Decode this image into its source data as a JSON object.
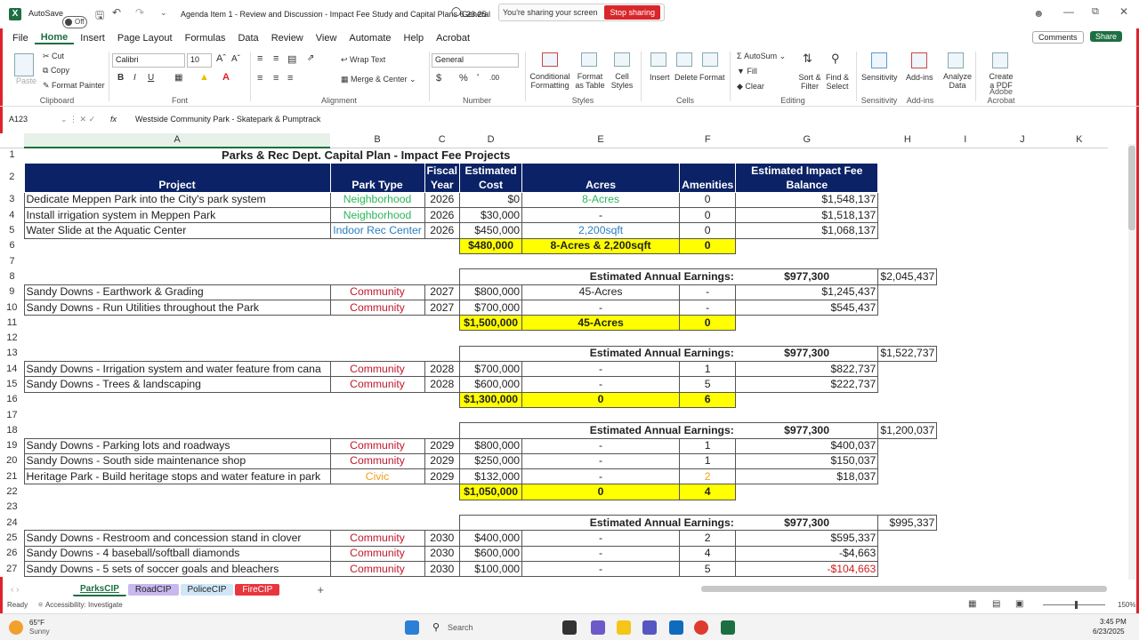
{
  "titlebar": {
    "autosave": "AutoSave",
    "toggle": "Off",
    "doc_title": "Agenda Item 1 - Review and Discussion - Impact Fee Study and  Capital Plans 6.23.25",
    "sensitivity": "General",
    "sharing_text": "You're sharing your screen",
    "stop_label": "Stop sharing"
  },
  "menu": [
    "File",
    "Home",
    "Insert",
    "Page Layout",
    "Formulas",
    "Data",
    "Review",
    "View",
    "Automate",
    "Help",
    "Acrobat"
  ],
  "comments_label": "Comments",
  "share_label": "Share",
  "ribbon": {
    "paste": "Paste",
    "cut": "Cut",
    "copy": "Copy",
    "format_painter": "Format Painter",
    "clipboard": "Clipboard",
    "font_name": "Calibri",
    "font_size": "10",
    "font": "Font",
    "wrap_text": "Wrap Text",
    "merge_center": "Merge & Center",
    "alignment": "Alignment",
    "number_format": "General",
    "number": "Number",
    "conditional": "Conditional Formatting",
    "format_table": "Format as Table",
    "cell_styles": "Cell Styles",
    "styles": "Styles",
    "insert": "Insert",
    "delete": "Delete",
    "format": "Format",
    "cells": "Cells",
    "autosum": "AutoSum",
    "fill": "Fill",
    "clear": "Clear",
    "sort_filter": "Sort & Filter",
    "find_select": "Find & Select",
    "editing": "Editing",
    "sensitivity": "Sensitivity",
    "addins": "Add-ins",
    "analyze_data": "Analyze Data",
    "create_pdf": "Create a PDF",
    "adobe": "Adobe Acrobat"
  },
  "formula_bar": {
    "name_box": "A123",
    "fx": "fx",
    "content": "Westside Community Park - Skatepark & Pumptrack"
  },
  "columns": [
    "A",
    "B",
    "C",
    "D",
    "E",
    "F",
    "G",
    "H",
    "I",
    "J",
    "K"
  ],
  "sheet_title": "Parks & Rec Dept.  Capital Plan - Impact Fee Projects",
  "headers": {
    "project": "Project",
    "park_type": "Park Type",
    "fiscal": "Fiscal",
    "year": "Year",
    "estimated": "Estimated",
    "cost": "Cost",
    "acres": "Acres",
    "amenities": "Amenities",
    "impact1": "Estimated Impact Fee",
    "impact2": "Balance"
  },
  "rows": [
    {
      "n": "3",
      "a": "Dedicate Meppen Park into the City's park system",
      "b": "Neighborhood",
      "bc": "green",
      "c": "2026",
      "d": "$0",
      "e": "8-Acres",
      "ec": "green",
      "f": "0",
      "g": "$1,548,137"
    },
    {
      "n": "4",
      "a": "Install irrigation system in Meppen Park",
      "b": "Neighborhood",
      "bc": "green",
      "c": "2026",
      "d": "$30,000",
      "e": "-",
      "f": "0",
      "g": "$1,518,137"
    },
    {
      "n": "5",
      "a": "Water Slide at the Aquatic Center",
      "b": "Indoor Rec Center",
      "bc": "blue",
      "c": "2026",
      "d": "$450,000",
      "e": "2,200sqft",
      "ec": "blue",
      "f": "0",
      "g": "$1,068,137"
    },
    {
      "n": "6",
      "total": true,
      "d": "$480,000",
      "e": "8-Acres & 2,200sqft",
      "f": "0"
    },
    {
      "n": "7",
      "blank": true
    },
    {
      "n": "8",
      "earn": true,
      "label": "Estimated Annual Earnings:",
      "val": "$977,300",
      "g": "$2,045,437"
    },
    {
      "n": "9",
      "a": "Sandy Downs - Earthwork & Grading",
      "b": "Community",
      "bc": "red",
      "c": "2027",
      "d": "$800,000",
      "e": "45-Acres",
      "f": "-",
      "g": "$1,245,437"
    },
    {
      "n": "10",
      "a": "Sandy Downs - Run Utilities throughout the Park",
      "b": "Community",
      "bc": "red",
      "c": "2027",
      "d": "$700,000",
      "e": "-",
      "f": "-",
      "g": "$545,437"
    },
    {
      "n": "11",
      "total": true,
      "d": "$1,500,000",
      "e": "45-Acres",
      "f": "0"
    },
    {
      "n": "12",
      "blank": true
    },
    {
      "n": "13",
      "earn": true,
      "label": "Estimated Annual Earnings:",
      "val": "$977,300",
      "g": "$1,522,737"
    },
    {
      "n": "14",
      "a": "Sandy Downs - Irrigation system and water feature from cana",
      "b": "Community",
      "bc": "red",
      "c": "2028",
      "d": "$700,000",
      "e": "-",
      "f": "1",
      "g": "$822,737"
    },
    {
      "n": "15",
      "a": "Sandy Downs - Trees & landscaping",
      "b": "Community",
      "bc": "red",
      "c": "2028",
      "d": "$600,000",
      "e": "-",
      "f": "5",
      "g": "$222,737"
    },
    {
      "n": "16",
      "total": true,
      "d": "$1,300,000",
      "e": "0",
      "f": "6"
    },
    {
      "n": "17",
      "blank": true
    },
    {
      "n": "18",
      "earn": true,
      "label": "Estimated Annual Earnings:",
      "val": "$977,300",
      "g": "$1,200,037"
    },
    {
      "n": "19",
      "a": "Sandy Downs - Parking lots and roadways",
      "b": "Community",
      "bc": "red",
      "c": "2029",
      "d": "$800,000",
      "e": "-",
      "f": "1",
      "g": "$400,037"
    },
    {
      "n": "20",
      "a": "Sandy Downs - South side maintenance shop",
      "b": "Community",
      "bc": "red",
      "c": "2029",
      "d": "$250,000",
      "e": "-",
      "f": "1",
      "g": "$150,037"
    },
    {
      "n": "21",
      "a": "Heritage Park - Build heritage stops and water feature in park",
      "b": "Civic",
      "bc": "orange",
      "c": "2029",
      "d": "$132,000",
      "e": "-",
      "f": "2",
      "fc": "orange",
      "g": "$18,037"
    },
    {
      "n": "22",
      "total": true,
      "d": "$1,050,000",
      "e": "0",
      "f": "4"
    },
    {
      "n": "23",
      "blank": true
    },
    {
      "n": "24",
      "earn": true,
      "label": "Estimated Annual Earnings:",
      "val": "$977,300",
      "g": "$995,337"
    },
    {
      "n": "25",
      "a": "Sandy Downs - Restroom and concession stand in clover",
      "b": "Community",
      "bc": "red",
      "c": "2030",
      "d": "$400,000",
      "e": "-",
      "f": "2",
      "g": "$595,337"
    },
    {
      "n": "26",
      "a": "Sandy Downs - 4 baseball/softball diamonds",
      "b": "Community",
      "bc": "red",
      "c": "2030",
      "d": "$600,000",
      "e": "-",
      "f": "4",
      "g": "-$4,663"
    },
    {
      "n": "27",
      "a": "Sandy Downs - 5 sets of soccer goals and bleachers",
      "b": "Community",
      "bc": "red",
      "c": "2030",
      "d": "$100,000",
      "e": "-",
      "f": "5",
      "g": "-$104,663",
      "gc": "ng"
    }
  ],
  "tabs": [
    {
      "label": "ParksCIP",
      "color": "#ffffff"
    },
    {
      "label": "RoadCIP",
      "color": "#c9b8f0"
    },
    {
      "label": "PoliceCIP",
      "color": "#cfe6f7"
    },
    {
      "label": "FireCIP",
      "color": "#e8353e"
    }
  ],
  "status": {
    "ready": "Ready",
    "access": "Accessibility: Investigate",
    "zoom": "150%"
  },
  "taskbar": {
    "temp": "65°F",
    "weather": "Sunny",
    "search": "Search",
    "time": "3:45 PM",
    "date": "6/23/2025"
  }
}
